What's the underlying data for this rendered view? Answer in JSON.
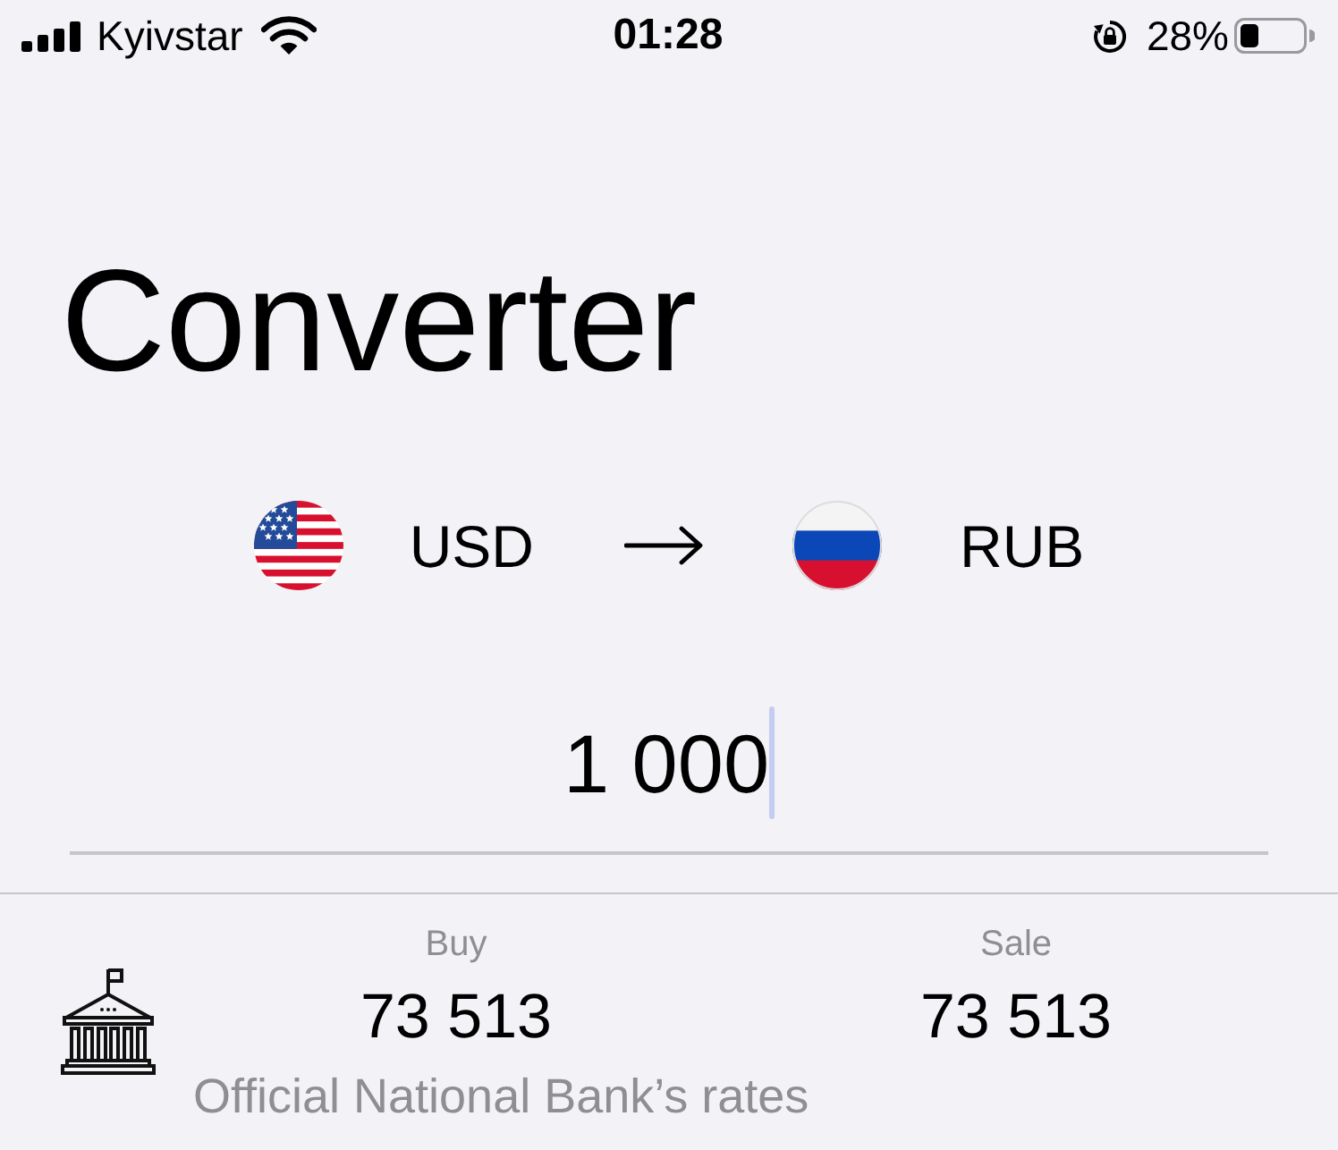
{
  "status_bar": {
    "carrier": "Kyivstar",
    "time": "01:28",
    "battery": "28%"
  },
  "title": "Converter",
  "currencies": [
    {
      "code": "USD",
      "kind": "us"
    },
    {
      "code": "RUB",
      "kind": "ru"
    }
  ],
  "amount": {
    "value": "1 000",
    "focused": true
  },
  "rates": {
    "columns": [
      {
        "label": "Buy",
        "value": "73 513"
      },
      {
        "label": "Sale",
        "value": "73 513"
      }
    ],
    "source": "Official National Bank’s rates"
  }
}
